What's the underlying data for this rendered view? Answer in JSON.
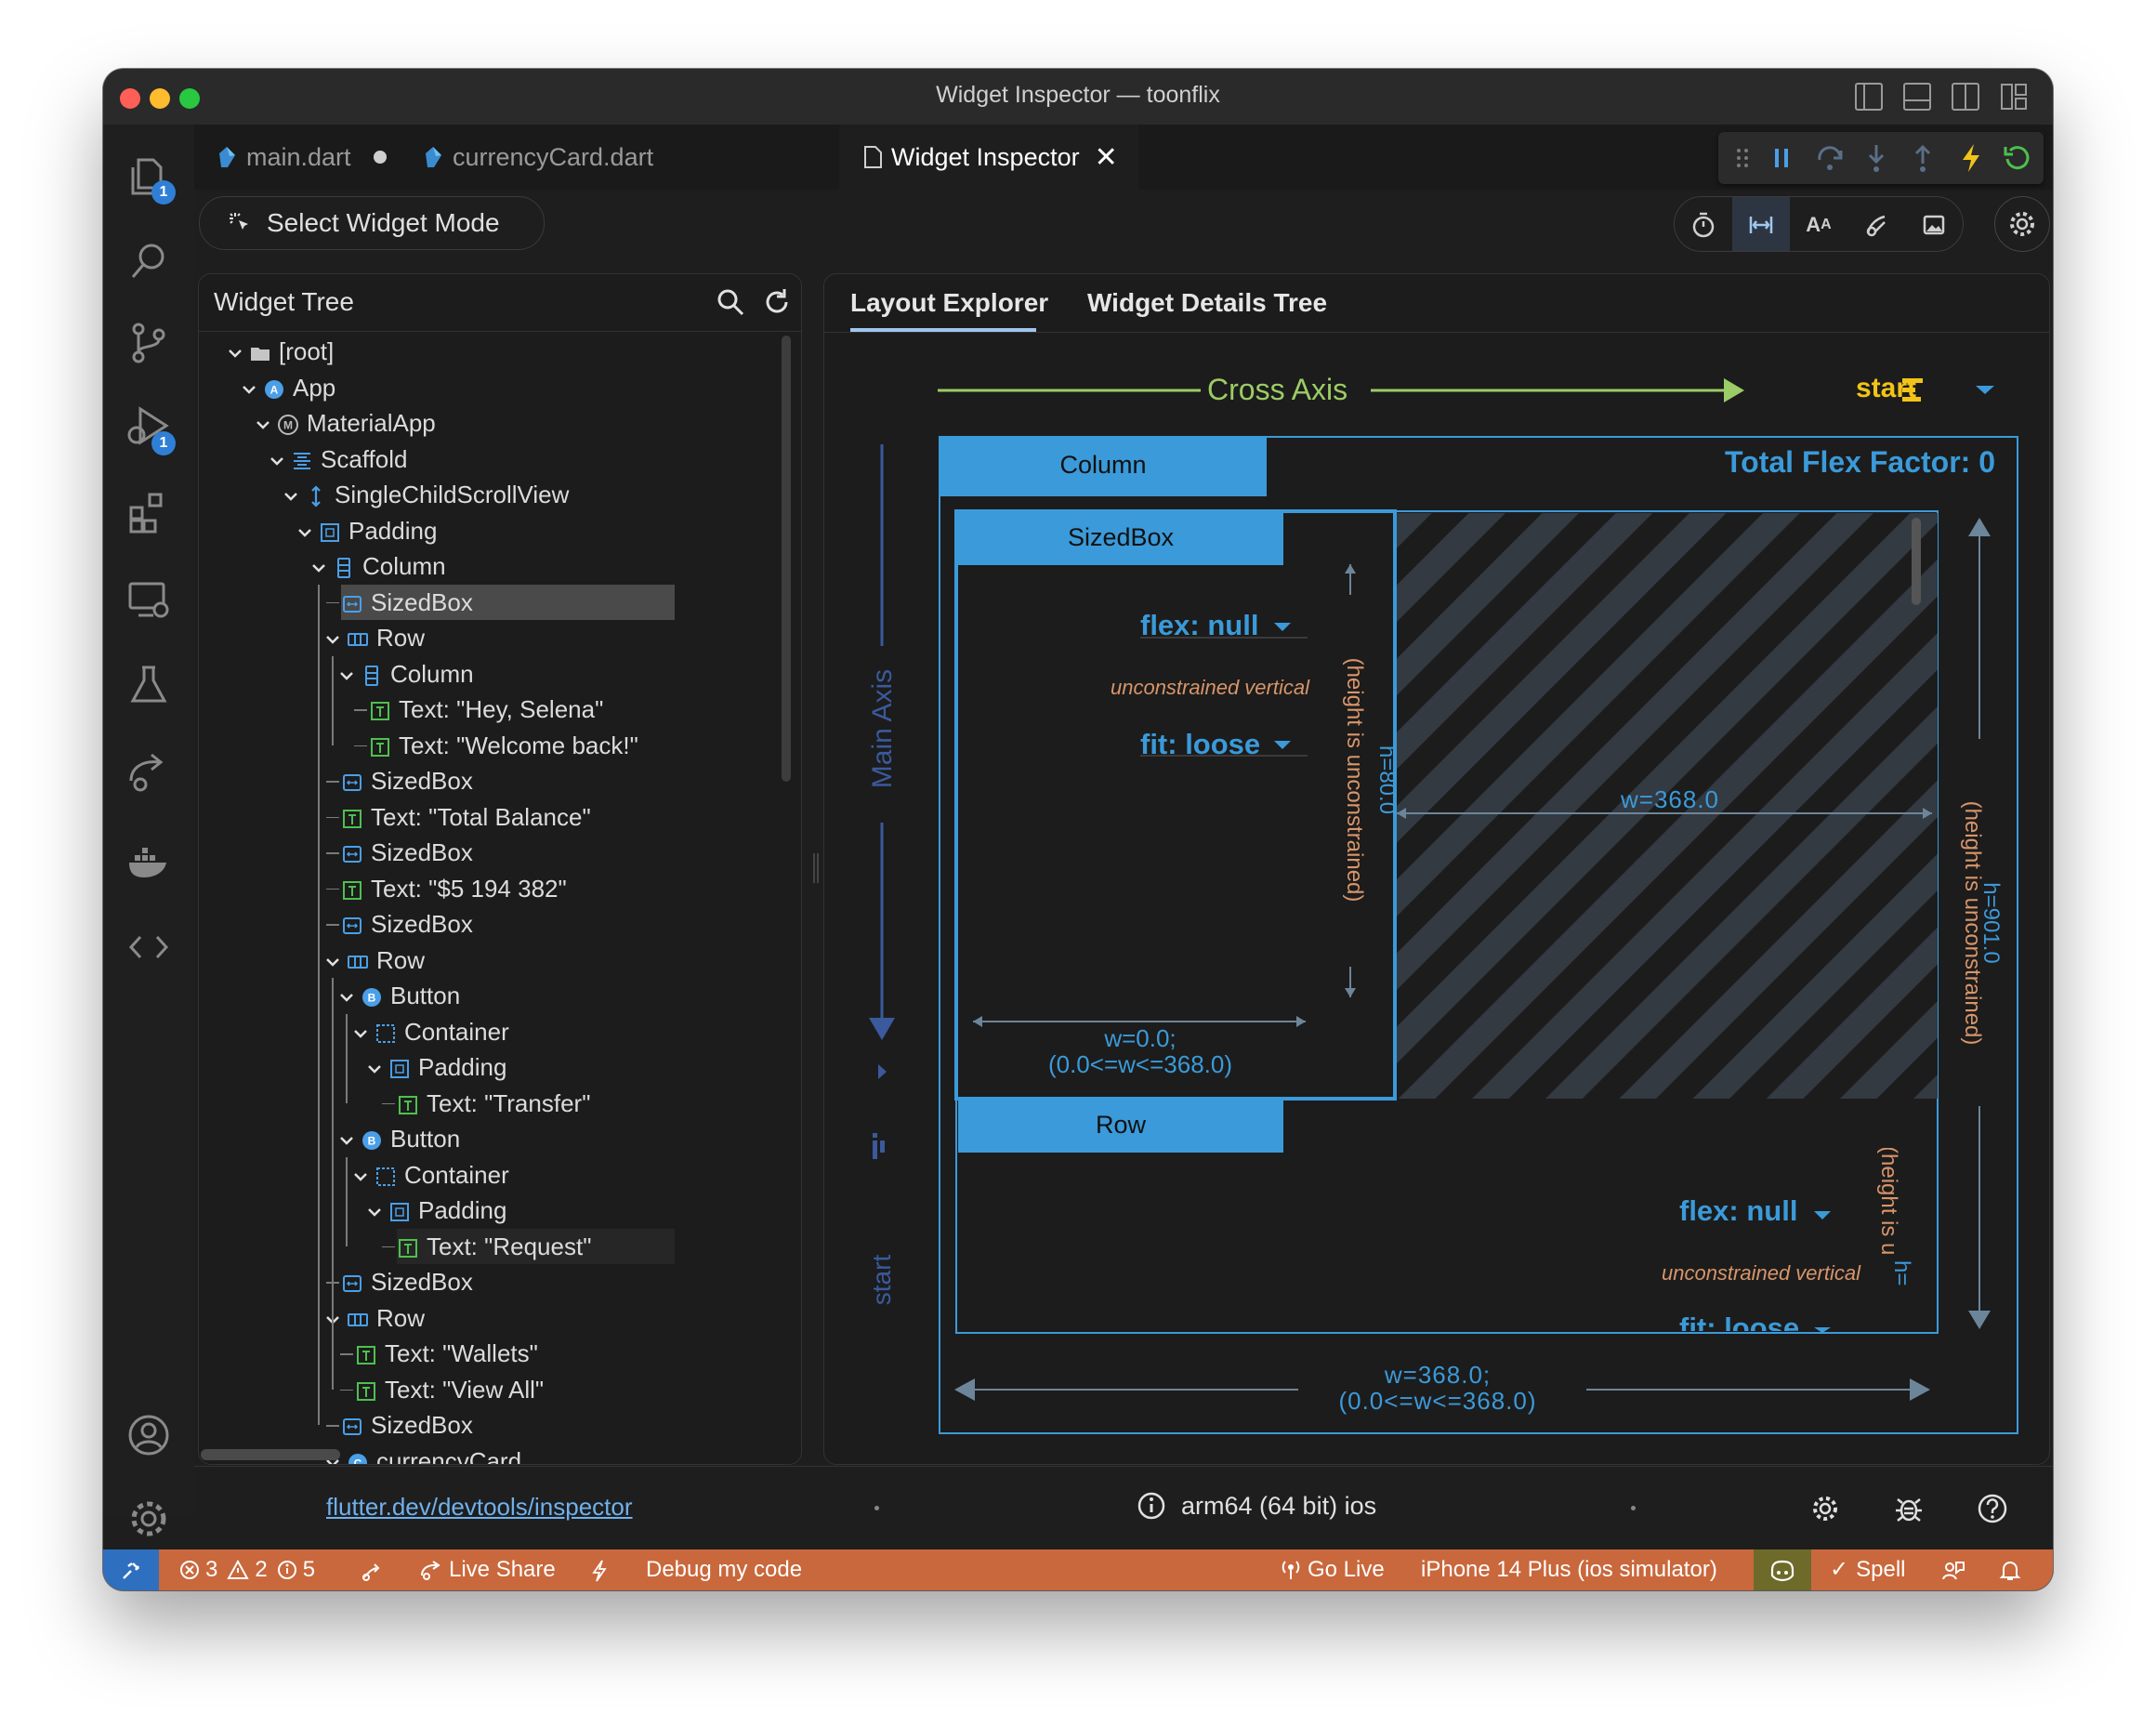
{
  "window": {
    "title": "Widget Inspector — toonflix"
  },
  "activity_bar": {
    "explorer_badge": "1",
    "debug_badge": "1"
  },
  "tabs": [
    {
      "label": "main.dart",
      "modified": true
    },
    {
      "label": "currencyCard.dart"
    },
    {
      "label": "Widget Inspector",
      "active": true
    }
  ],
  "toolbar": {
    "select_widget_mode": "Select Widget Mode"
  },
  "tree": {
    "title": "Widget Tree",
    "rows": [
      {
        "label": "[root]",
        "icon": "folder-icon"
      },
      {
        "label": "App",
        "icon": "a-circle-icon"
      },
      {
        "label": "MaterialApp",
        "icon": "m-circle-icon"
      },
      {
        "label": "Scaffold",
        "icon": "scaffold-icon"
      },
      {
        "label": "SingleChildScrollView",
        "icon": "scroll-icon"
      },
      {
        "label": "Padding",
        "icon": "padding-icon"
      },
      {
        "label": "Column",
        "icon": "column-icon"
      },
      {
        "label": "SizedBox",
        "icon": "sizedbox-icon",
        "selected": true
      },
      {
        "label": "Row",
        "icon": "row-icon"
      },
      {
        "label": "Column",
        "icon": "column-icon"
      },
      {
        "label": "Text: \"Hey, Selena\"",
        "icon": "text-icon"
      },
      {
        "label": "Text: \"Welcome back!\"",
        "icon": "text-icon"
      },
      {
        "label": "SizedBox",
        "icon": "sizedbox-icon"
      },
      {
        "label": "Text: \"Total Balance\"",
        "icon": "text-icon"
      },
      {
        "label": "SizedBox",
        "icon": "sizedbox-icon"
      },
      {
        "label": "Text: \"$5 194 382\"",
        "icon": "text-icon"
      },
      {
        "label": "SizedBox",
        "icon": "sizedbox-icon"
      },
      {
        "label": "Row",
        "icon": "row-icon"
      },
      {
        "label": "Button",
        "icon": "b-circle-icon"
      },
      {
        "label": "Container",
        "icon": "container-icon"
      },
      {
        "label": "Padding",
        "icon": "padding-icon"
      },
      {
        "label": "Text: \"Transfer\"",
        "icon": "text-icon"
      },
      {
        "label": "Button",
        "icon": "b-circle-icon"
      },
      {
        "label": "Container",
        "icon": "container-icon"
      },
      {
        "label": "Padding",
        "icon": "padding-icon"
      },
      {
        "label": "Text: \"Request\"",
        "icon": "text-icon",
        "hovered": true
      },
      {
        "label": "SizedBox",
        "icon": "sizedbox-icon"
      },
      {
        "label": "Row",
        "icon": "row-icon"
      },
      {
        "label": "Text: \"Wallets\"",
        "icon": "text-icon"
      },
      {
        "label": "Text: \"View All\"",
        "icon": "text-icon"
      },
      {
        "label": "SizedBox",
        "icon": "sizedbox-icon"
      },
      {
        "label": "currencyCard",
        "icon": "c-circle-icon"
      }
    ]
  },
  "layout": {
    "tabs": [
      "Layout Explorer",
      "Widget Details Tree"
    ],
    "active_tab": "Layout Explorer",
    "cross_axis_label": "Cross Axis",
    "cross_axis_value": "start",
    "main_axis_label": "Main Axis",
    "main_axis_value": "start",
    "parent_label": "Column",
    "total_flex": "Total Flex Factor: 0",
    "child1": {
      "label": "SizedBox",
      "flex": "flex: null",
      "unconstrained": "unconstrained vertical",
      "fit": "fit: loose",
      "height_note": "(height is unconstrained)",
      "height": "h=80.0",
      "width_line1": "w=0.0;",
      "width_line2": "(0.0<=w<=368.0)"
    },
    "free_space_width": "w=368.0",
    "child2": {
      "label": "Row",
      "flex": "flex: null",
      "unconstrained": "unconstrained vertical",
      "fit": "fit: loose",
      "height_note": "(height is u",
      "height": "h="
    },
    "outer_height_note": "(height is unconstrained)",
    "outer_height": "h=901.0",
    "outer_width_line1": "w=368.0;",
    "outer_width_line2": "(0.0<=w<=368.0)"
  },
  "footer": {
    "link": "flutter.dev/devtools/inspector",
    "platform": "arm64 (64 bit) ios"
  },
  "status": {
    "errors": "3",
    "warnings": "2",
    "infos": "5",
    "live_share": "Live Share",
    "debug": "Debug my code",
    "go_live": "Go Live",
    "device": "iPhone 14 Plus (ios simulator)",
    "spell": "Spell"
  },
  "colors": {
    "accent": "#3b9ad9",
    "cross_axis": "#9ccc65",
    "orange_hint": "#d7956a",
    "status_bar": "#c9683c"
  }
}
